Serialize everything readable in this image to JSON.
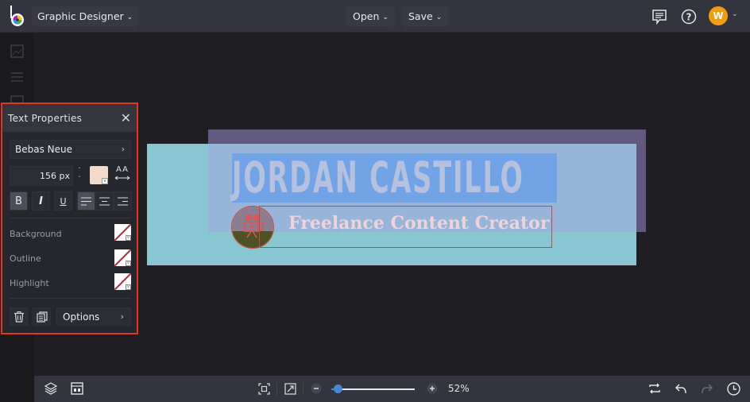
{
  "topbar": {
    "project_label": "Graphic Designer",
    "open_label": "Open",
    "save_label": "Save",
    "avatar_initial": "W",
    "icons": [
      "logo-icon",
      "comments-icon",
      "help-icon",
      "avatar"
    ]
  },
  "panel": {
    "title": "Text Properties",
    "font_name": "Bebas Neue",
    "font_size": "156 px",
    "text_color": "#f2dcc9",
    "aa_label": "AA",
    "format_buttons": [
      {
        "label": "B",
        "name": "bold",
        "active": true
      },
      {
        "label": "I",
        "name": "italic",
        "active": false
      },
      {
        "label": "U",
        "name": "underline",
        "active": false
      }
    ],
    "align_buttons": [
      {
        "name": "align-left",
        "active": true
      },
      {
        "name": "align-center",
        "active": false
      },
      {
        "name": "align-right",
        "active": false
      }
    ],
    "properties": [
      {
        "label": "Background",
        "value": "none"
      },
      {
        "label": "Outline",
        "value": "none"
      },
      {
        "label": "Highlight",
        "value": "none"
      }
    ],
    "options_label": "Options"
  },
  "design": {
    "title": "JORDAN CASTILLO",
    "subtitle": "Freelance Content Creator"
  },
  "bottombar": {
    "zoom_percent": "52%",
    "zoom_value": 0.52,
    "zoom_slider_fraction": 0.08
  },
  "colors": {
    "accent_selection": "#e3361c",
    "brand_blue": "#4a86d8",
    "avatar": "#f39c12"
  }
}
